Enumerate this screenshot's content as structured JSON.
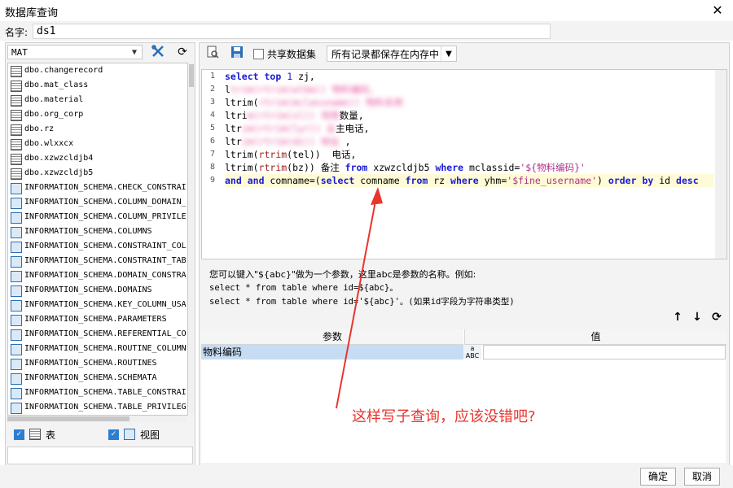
{
  "window": {
    "title": "数据库查询",
    "close": "✕"
  },
  "name_row": {
    "label": "名字:",
    "value": "ds1"
  },
  "left": {
    "schema": "MAT",
    "tables": [
      {
        "name": "dbo.changerecord",
        "kind": "table"
      },
      {
        "name": "dbo.mat_class",
        "kind": "table"
      },
      {
        "name": "dbo.material",
        "kind": "table"
      },
      {
        "name": "dbo.org_corp",
        "kind": "table"
      },
      {
        "name": "dbo.rz",
        "kind": "table"
      },
      {
        "name": "dbo.wlxxcx",
        "kind": "table"
      },
      {
        "name": "dbo.xzwzcldjb4",
        "kind": "table"
      },
      {
        "name": "dbo.xzwzcldjb5",
        "kind": "table"
      },
      {
        "name": "INFORMATION_SCHEMA.CHECK_CONSTRAI",
        "kind": "view"
      },
      {
        "name": "INFORMATION_SCHEMA.COLUMN_DOMAIN_",
        "kind": "view"
      },
      {
        "name": "INFORMATION_SCHEMA.COLUMN_PRIVILE",
        "kind": "view"
      },
      {
        "name": "INFORMATION_SCHEMA.COLUMNS",
        "kind": "view"
      },
      {
        "name": "INFORMATION_SCHEMA.CONSTRAINT_COL",
        "kind": "view"
      },
      {
        "name": "INFORMATION_SCHEMA.CONSTRAINT_TAB",
        "kind": "view"
      },
      {
        "name": "INFORMATION_SCHEMA.DOMAIN_CONSTRA",
        "kind": "view"
      },
      {
        "name": "INFORMATION_SCHEMA.DOMAINS",
        "kind": "view"
      },
      {
        "name": "INFORMATION_SCHEMA.KEY_COLUMN_USA",
        "kind": "view"
      },
      {
        "name": "INFORMATION_SCHEMA.PARAMETERS",
        "kind": "view"
      },
      {
        "name": "INFORMATION_SCHEMA.REFERENTIAL_CO",
        "kind": "view"
      },
      {
        "name": "INFORMATION_SCHEMA.ROUTINE_COLUMN",
        "kind": "view"
      },
      {
        "name": "INFORMATION_SCHEMA.ROUTINES",
        "kind": "view"
      },
      {
        "name": "INFORMATION_SCHEMA.SCHEMATA",
        "kind": "view"
      },
      {
        "name": "INFORMATION_SCHEMA.TABLE_CONSTRAI",
        "kind": "view"
      },
      {
        "name": "INFORMATION_SCHEMA.TABLE_PRIVILEG",
        "kind": "view"
      }
    ],
    "check_table": "表",
    "check_view": "视图"
  },
  "toolbar": {
    "share_label": "共享数据集",
    "memory_option": "所有记录都保存在内存中"
  },
  "editor": {
    "line_numbers": [
      "1",
      "2",
      "3",
      "4",
      "5",
      "6",
      "7",
      "8",
      "9"
    ]
  },
  "hint": {
    "line1": "您可以键入\"${abc}\"做为一个参数，这里abc是参数的名称。例如:",
    "line2": "select * from table where id=${abc}。",
    "line3": "select * from table where id='${abc}'。(如果id字段为字符串类型)"
  },
  "params": {
    "col_param": "参数",
    "col_value": "值",
    "rows": [
      {
        "name": "物料编码",
        "value": ""
      }
    ],
    "type_icon": "ABC"
  },
  "footer": {
    "ok": "确定",
    "cancel": "取消"
  },
  "annotation": {
    "text": "这样写子查询，应该没错吧?",
    "color": "#e8352e"
  }
}
